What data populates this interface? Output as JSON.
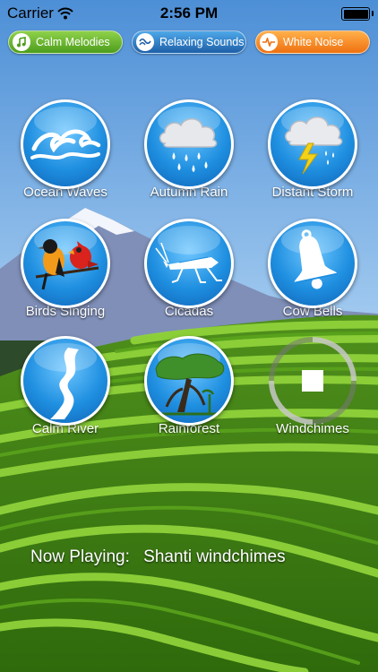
{
  "status": {
    "carrier": "Carrier",
    "time": "2:56 PM"
  },
  "tabs": [
    {
      "label": "Calm Melodies",
      "icon": "music-note-icon",
      "color": "#5fae2a"
    },
    {
      "label": "Relaxing Sounds",
      "icon": "wave-icon",
      "color": "#2f7bc8"
    },
    {
      "label": "White Noise",
      "icon": "pulse-icon",
      "color": "#f58a24"
    }
  ],
  "sounds": [
    {
      "label": "Ocean Waves",
      "icon": "waves-icon"
    },
    {
      "label": "Autumn Rain",
      "icon": "rain-cloud-icon"
    },
    {
      "label": "Distant Storm",
      "icon": "storm-cloud-icon"
    },
    {
      "label": "Birds Singing",
      "icon": "birds-icon"
    },
    {
      "label": "Cicadas",
      "icon": "cicada-icon"
    },
    {
      "label": "Cow Bells",
      "icon": "bell-icon"
    },
    {
      "label": "Calm River",
      "icon": "river-icon"
    },
    {
      "label": "Rainforest",
      "icon": "tree-icon"
    },
    {
      "label": "Windchimes",
      "icon": "stop-icon",
      "playing": true
    }
  ],
  "now_playing": {
    "label": "Now Playing:",
    "track": "Shanti windchimes"
  }
}
